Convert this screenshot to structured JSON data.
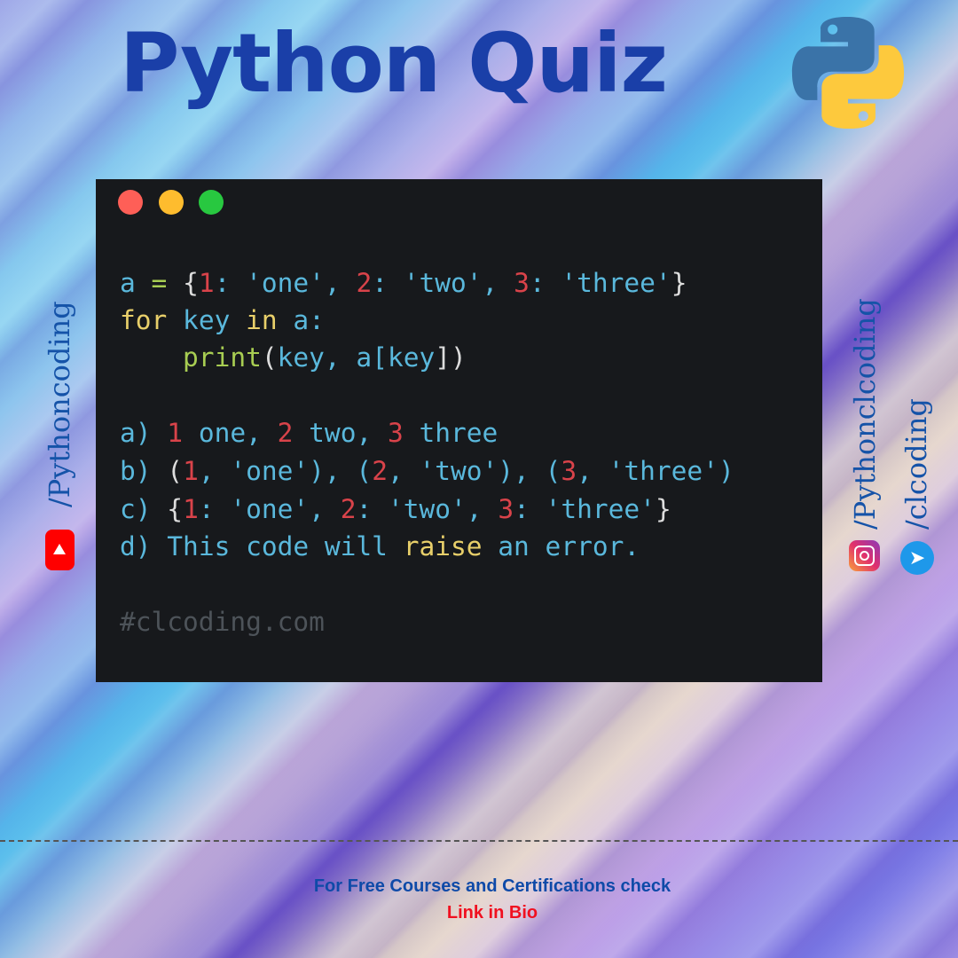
{
  "title": "Python Quiz",
  "window_controls": [
    "close",
    "minimize",
    "maximize"
  ],
  "colors": {
    "title": "#1a3fa8",
    "close": "#fe5f57",
    "minimize": "#febc2e",
    "maximize": "#28c840",
    "code_bg": "#17191c",
    "link": "#f01020"
  },
  "code": {
    "line1": {
      "a": "a",
      "eq": "=",
      "ob": "{",
      "k1": "1",
      "s1": ": 'one', ",
      "k2": "2",
      "s2": ": 'two', ",
      "k3": "3",
      "s3": ": 'three'",
      "cb": "}"
    },
    "line2": {
      "for": "for",
      "rest1": " key ",
      "in": "in",
      "rest2": " a:"
    },
    "line3": {
      "print": "print",
      "op": "(",
      "args": "key, a[key",
      "cp": "])"
    }
  },
  "options": {
    "a": {
      "label": "a)",
      "n1": "1",
      "t1": " one, ",
      "n2": "2",
      "t2": " two, ",
      "n3": "3",
      "t3": " three"
    },
    "b": {
      "label": "b)",
      "o": "(",
      "n1": "1",
      "t1": ", 'one'), (",
      "n2": "2",
      "t2": ", 'two'), (",
      "n3": "3",
      "t3": ", 'three')"
    },
    "c": {
      "label": "c)",
      "o": "{",
      "n1": "1",
      "t1": ": 'one', ",
      "n2": "2",
      "t2": ": 'two', ",
      "n3": "3",
      "t3": ": 'three'",
      "cl": "}"
    },
    "d": {
      "label": "d)",
      "t1": " This code will ",
      "kw": "raise",
      "t2": " an error."
    }
  },
  "comment": "#clcoding.com",
  "social": {
    "youtube": "/Pythoncoding",
    "instagram": "/Pythonclcoding",
    "other": "/clcoding"
  },
  "footer": {
    "line1": "For Free Courses and Certifications check",
    "line2": "Link in Bio"
  }
}
